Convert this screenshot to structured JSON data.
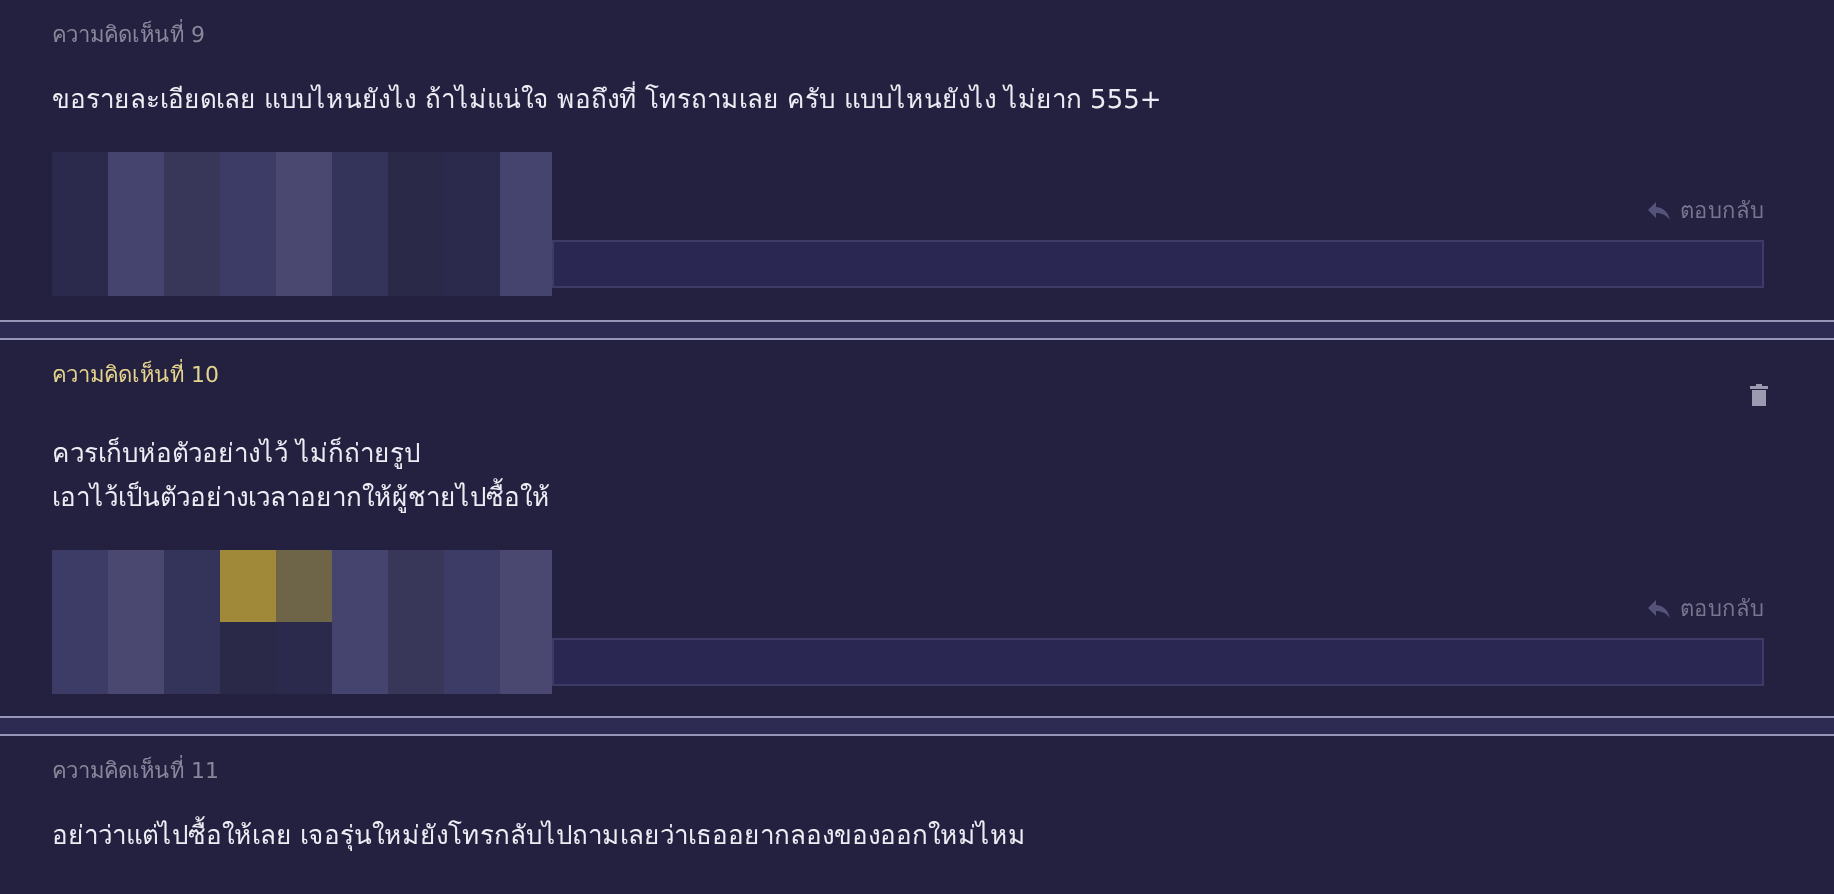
{
  "comments": [
    {
      "title": "ความคิดเห็นที่ 9",
      "highlighted": false,
      "deletable": false,
      "lines": [
        "ขอรายละเอียดเลย แบบไหนยังไง ถ้าไม่แน่ใจ พอถึงที่ โทรถามเลย ครับ แบบไหนยังไง ไม่ยาก 555+"
      ],
      "reply": "ตอบกลับ"
    },
    {
      "title": "ความคิดเห็นที่ 10",
      "highlighted": true,
      "deletable": true,
      "lines": [
        "ควรเก็บห่อตัวอย่างไว้ ไม่ก็ถ่ายรูป",
        "เอาไว้เป็นตัวอย่างเวลาอยากให้ผู้ชายไปซื้อให้"
      ],
      "reply": "ตอบกลับ"
    },
    {
      "title": "ความคิดเห็นที่ 11",
      "highlighted": false,
      "deletable": false,
      "lines": [
        "อย่าว่าแต่ไปซื้อให้เลย เจอรุ่นใหม่ยังโทรกลับไปถามเลยว่าเธออยากลองของออกใหม่ไหม"
      ]
    }
  ]
}
